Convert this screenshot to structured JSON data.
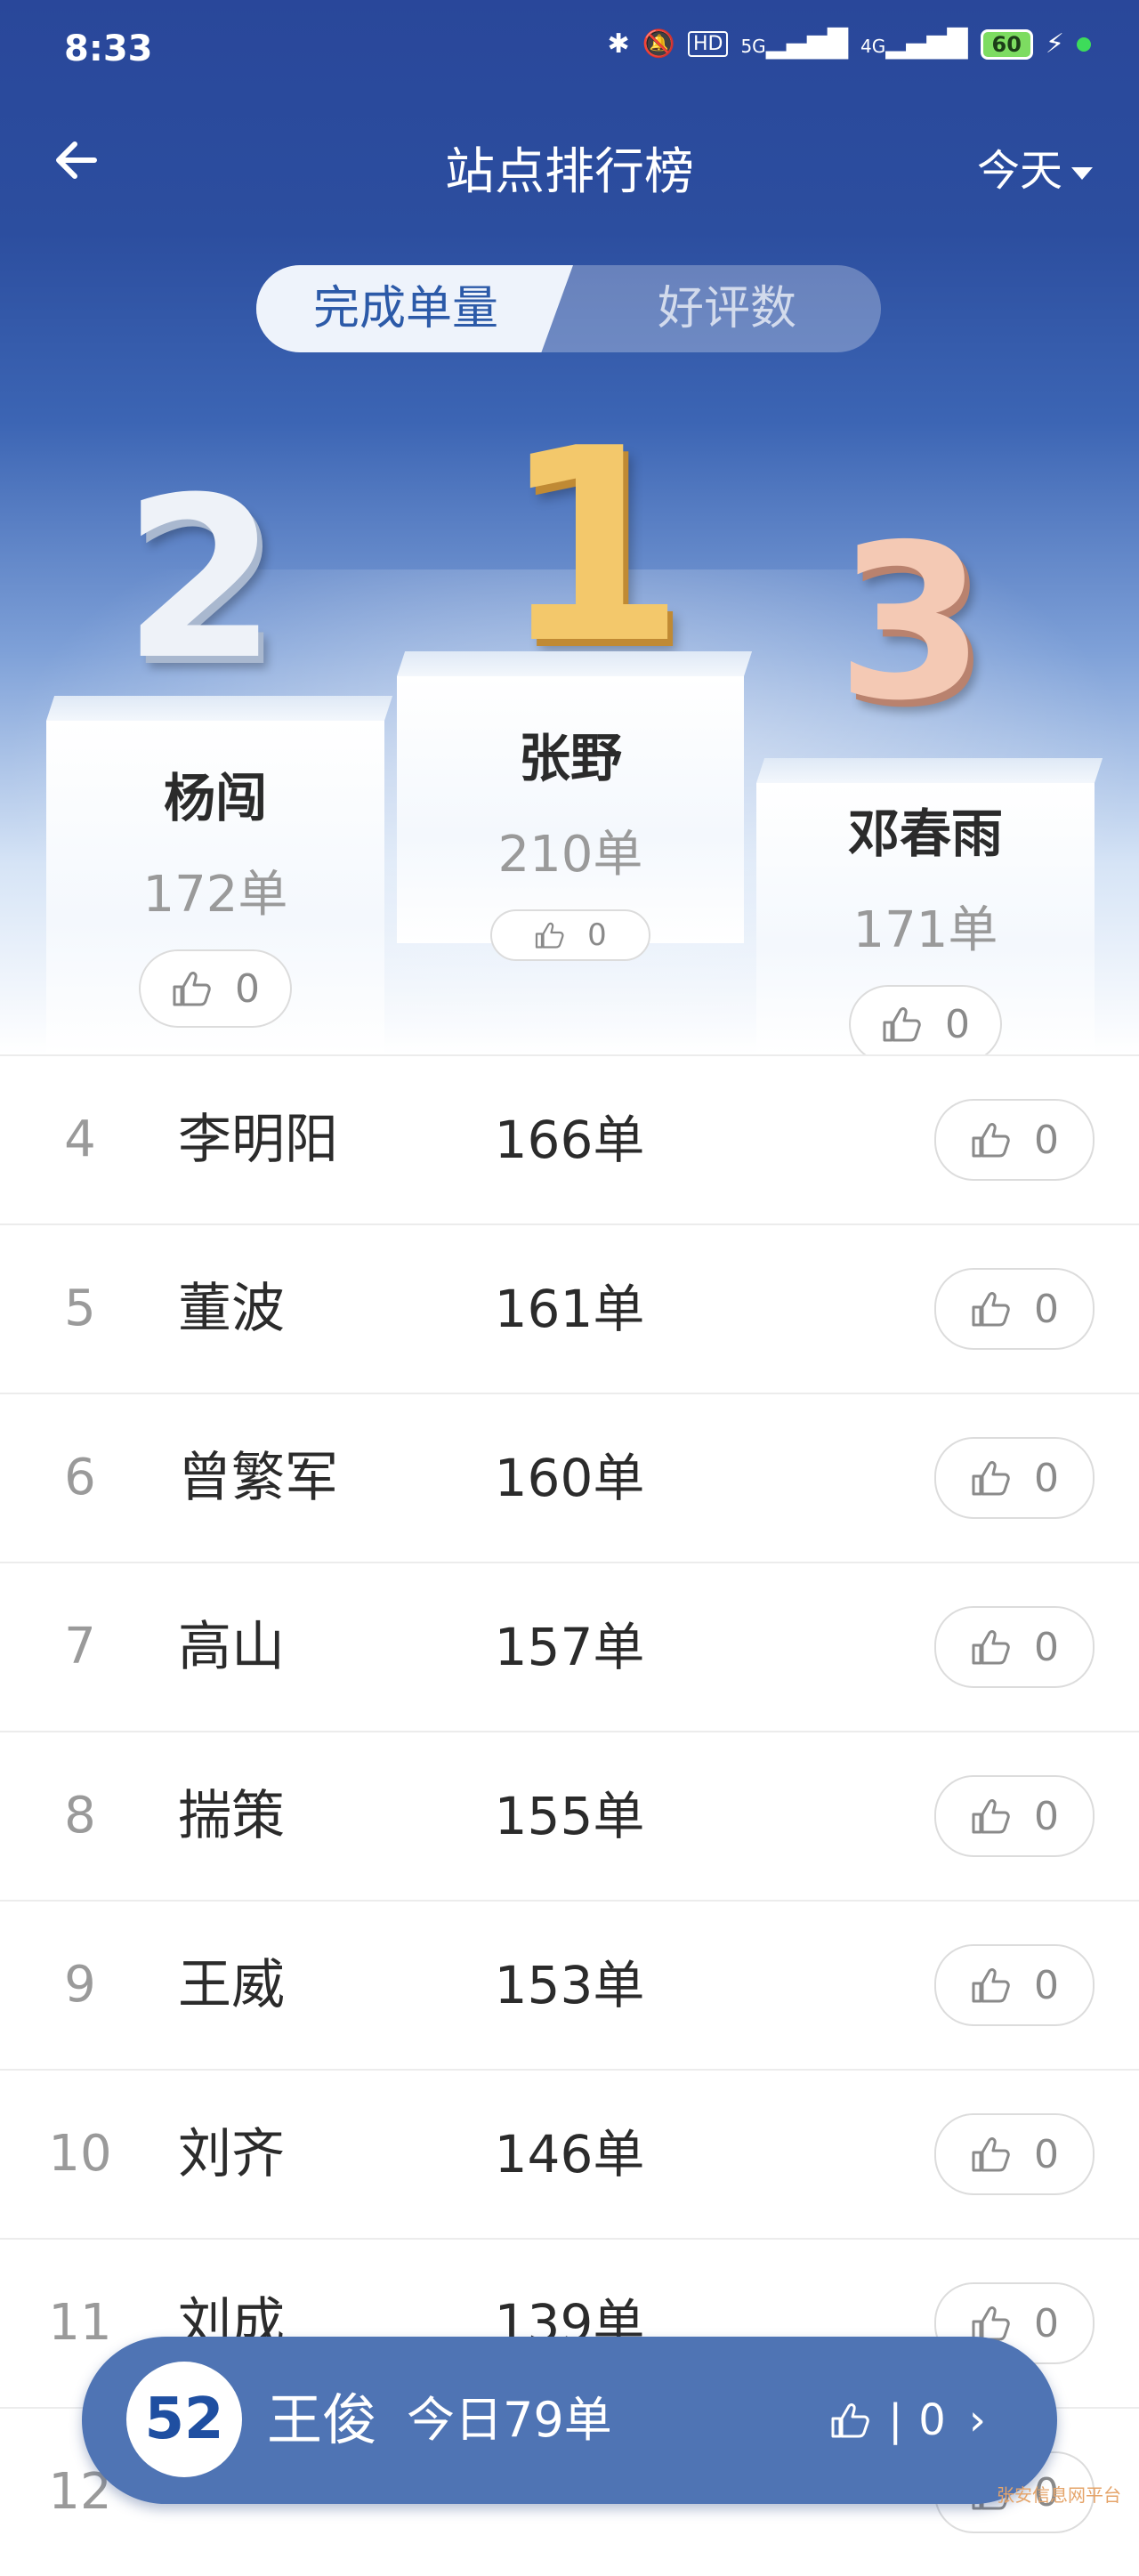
{
  "status_bar": {
    "time": "8:33",
    "battery": "60",
    "network": [
      "5G",
      "4G"
    ],
    "hd": "HD"
  },
  "nav": {
    "back_icon": "back-arrow",
    "title": "站点排行榜",
    "range": "今天"
  },
  "tabs": {
    "active": "完成单量",
    "inactive": "好评数"
  },
  "podium": {
    "first": {
      "rank": "1",
      "name": "张野",
      "count": "210单",
      "likes": "0"
    },
    "second": {
      "rank": "2",
      "name": "杨闯",
      "count": "172单",
      "likes": "0"
    },
    "third": {
      "rank": "3",
      "name": "邓春雨",
      "count": "171单",
      "likes": "0"
    }
  },
  "rows": [
    {
      "rank": "4",
      "name": "李明阳",
      "count": "166单",
      "likes": "0"
    },
    {
      "rank": "5",
      "name": "董波",
      "count": "161单",
      "likes": "0"
    },
    {
      "rank": "6",
      "name": "曾繁军",
      "count": "160单",
      "likes": "0"
    },
    {
      "rank": "7",
      "name": "高山",
      "count": "157单",
      "likes": "0"
    },
    {
      "rank": "8",
      "name": "揣策",
      "count": "155单",
      "likes": "0"
    },
    {
      "rank": "9",
      "name": "王威",
      "count": "153单",
      "likes": "0"
    },
    {
      "rank": "10",
      "name": "刘齐",
      "count": "146单",
      "likes": "0"
    },
    {
      "rank": "11",
      "name": "刘成",
      "count": "139单",
      "likes": "0"
    },
    {
      "rank": "12",
      "name": "",
      "count": "",
      "likes": "0"
    }
  ],
  "me": {
    "rank": "52",
    "name": "王俊",
    "today": "今日79单",
    "likes": "0",
    "separator": "|"
  },
  "watermark": "张安信息网平台",
  "colors": {
    "header_blue": "#2c4e9f",
    "accent": "#2c5aa8",
    "my_bar": "#4f74b4"
  }
}
